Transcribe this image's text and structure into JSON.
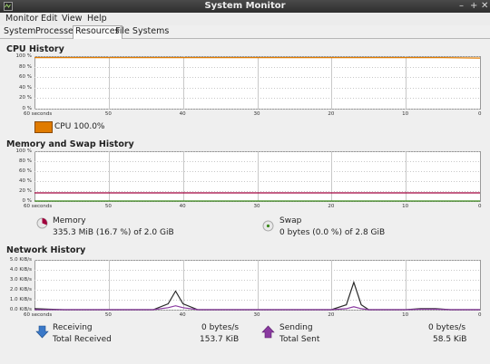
{
  "window": {
    "title": "System Monitor",
    "minimize": "–",
    "maximize": "+",
    "close": "✕"
  },
  "menu": [
    "Monitor",
    "Edit",
    "View",
    "Help"
  ],
  "tabs": [
    "System",
    "Processes",
    "Resources",
    "File Systems"
  ],
  "active_tab": "Resources",
  "cpu": {
    "title": "CPU History",
    "y_ticks": [
      "100 %",
      "80 %",
      "60 %",
      "40 %",
      "20 %",
      "0 %"
    ],
    "x_ticks": [
      "60 seconds",
      "50",
      "40",
      "30",
      "20",
      "10",
      "0"
    ],
    "legend_label": "CPU 100.0%",
    "color": "#e07b00"
  },
  "memory": {
    "title": "Memory and Swap History",
    "y_ticks": [
      "100 %",
      "80 %",
      "60 %",
      "40 %",
      "20 %",
      "0 %"
    ],
    "x_ticks": [
      "60 seconds",
      "50",
      "40",
      "30",
      "20",
      "10",
      "0"
    ],
    "memory_label": "Memory",
    "memory_value": "335.3 MiB (16.7 %) of 2.0 GiB",
    "swap_label": "Swap",
    "swap_value": "0 bytes (0.0 %) of 2.8 GiB",
    "memory_color": "#a0003c",
    "swap_color": "#3c8a1c"
  },
  "network": {
    "title": "Network History",
    "y_ticks": [
      "5.0 KiB/s",
      "4.0 KiB/s",
      "3.0 KiB/s",
      "2.0 KiB/s",
      "1.0 KiB/s",
      "0.0 KiB/s"
    ],
    "x_ticks": [
      "60 seconds",
      "50",
      "40",
      "30",
      "20",
      "10",
      "0"
    ],
    "receiving_label": "Receiving",
    "receiving_value": "0 bytes/s",
    "total_received_label": "Total Received",
    "total_received_value": "153.7 KiB",
    "sending_label": "Sending",
    "sending_value": "0 bytes/s",
    "total_sent_label": "Total Sent",
    "total_sent_value": "58.5 KiB",
    "receive_color": "#3a78c8",
    "send_color": "#8a3aa0"
  },
  "chart_data": [
    {
      "type": "line",
      "title": "CPU History",
      "x": [
        60,
        55,
        50,
        45,
        40,
        35,
        30,
        25,
        20,
        15,
        10,
        5,
        0
      ],
      "series": [
        {
          "name": "CPU",
          "values": [
            99,
            99,
            99,
            99,
            99,
            99,
            99,
            99,
            99,
            99,
            99,
            99,
            98
          ]
        }
      ],
      "ylim": [
        0,
        100
      ],
      "xlim": [
        60,
        0
      ]
    },
    {
      "type": "line",
      "title": "Memory and Swap History",
      "x": [
        60,
        50,
        40,
        30,
        20,
        10,
        0
      ],
      "series": [
        {
          "name": "Memory",
          "values": [
            16.7,
            16.7,
            16.7,
            16.7,
            16.7,
            16.7,
            16.7
          ]
        },
        {
          "name": "Swap",
          "values": [
            0,
            0,
            0,
            0,
            0,
            0,
            0
          ]
        }
      ],
      "ylim": [
        0,
        100
      ],
      "xlim": [
        60,
        0
      ]
    },
    {
      "type": "line",
      "title": "Network History",
      "x": [
        60,
        58,
        56,
        54,
        52,
        50,
        48,
        46,
        44,
        42,
        41,
        40,
        38,
        36,
        34,
        32,
        30,
        28,
        26,
        24,
        22,
        20,
        18,
        17,
        16,
        15,
        14,
        12,
        10,
        8,
        6,
        4,
        2,
        0
      ],
      "series": [
        {
          "name": "Receiving",
          "values": [
            0.1,
            0.05,
            0,
            0,
            0,
            0,
            0,
            0,
            0,
            0.6,
            1.9,
            0.6,
            0,
            0,
            0,
            0,
            0,
            0,
            0,
            0,
            0,
            0,
            0.5,
            2.8,
            0.5,
            0,
            0,
            0,
            0,
            0.1,
            0.1,
            0,
            0,
            0
          ]
        },
        {
          "name": "Sending",
          "values": [
            0,
            0,
            0,
            0,
            0,
            0,
            0,
            0,
            0,
            0.2,
            0.4,
            0.2,
            0,
            0,
            0,
            0,
            0,
            0,
            0,
            0,
            0,
            0,
            0.1,
            0.3,
            0.1,
            0,
            0,
            0,
            0,
            0.05,
            0.05,
            0,
            0,
            0
          ]
        }
      ],
      "ylim": [
        0,
        5
      ],
      "xlim": [
        60,
        0
      ]
    }
  ]
}
